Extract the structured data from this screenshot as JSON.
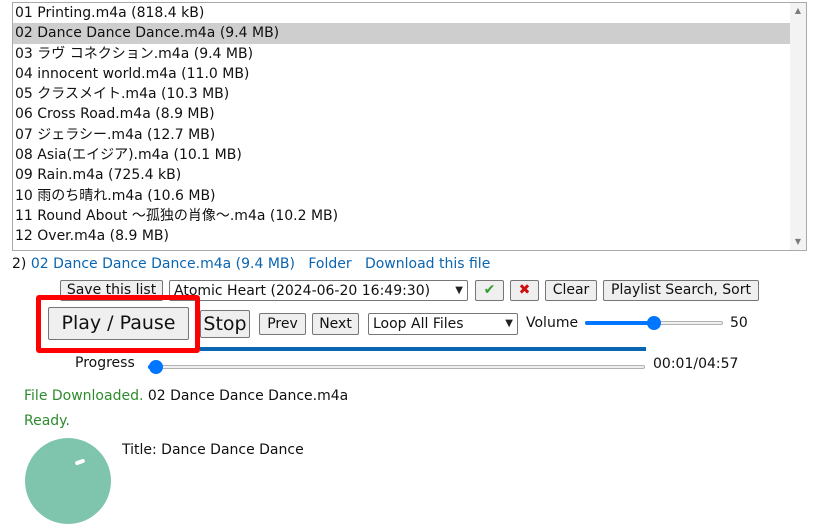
{
  "playlist": {
    "tracks": [
      "01 Printing.m4a (818.4 kB)",
      "02 Dance Dance Dance.m4a (9.4 MB)",
      "03 ラヴ コネクション.m4a (9.4 MB)",
      "04 innocent world.m4a (11.0 MB)",
      "05 クラスメイト.m4a (10.3 MB)",
      "06 Cross Road.m4a (8.9 MB)",
      "07 ジェラシー.m4a (12.7 MB)",
      "08 Asia(エイジア).m4a (10.1 MB)",
      "09 Rain.m4a (725.4 kB)",
      "10 雨のち晴れ.m4a (10.6 MB)",
      "11 Round About ～孤独の肖像～.m4a (10.2 MB)",
      "12 Over.m4a (8.9 MB)"
    ],
    "selected_index": 1
  },
  "info": {
    "index": "2)",
    "file_link": "02 Dance Dance Dance.m4a (9.4 MB)",
    "folder_link": "Folder",
    "download_link": "Download this file"
  },
  "toolbar": {
    "save_label": "Save this list",
    "playlist_select": "Atomic Heart (2024-06-20 16:49:30)",
    "confirm_icon": "✔",
    "delete_icon": "✖",
    "clear_label": "Clear",
    "search_label": "Playlist Search, Sort"
  },
  "controls": {
    "play_pause_label": "Play / Pause",
    "stop_label": "Stop",
    "prev_label": "Prev",
    "next_label": "Next",
    "loop_select": "Loop All Files",
    "volume_label": "Volume",
    "volume_value": "50",
    "volume_fraction": 0.5
  },
  "progress": {
    "label": "Progress",
    "time": "00:01/04:57",
    "fraction": 0.003
  },
  "status": {
    "downloaded_label": "File Downloaded.",
    "downloaded_file": "02 Dance Dance Dance.m4a",
    "ready": "Ready.",
    "title_line": "Title: Dance Dance Dance"
  },
  "colors": {
    "accent": "#0075ff",
    "link": "#0b65b0",
    "highlight": "#ff0000",
    "status_green": "#2e8b2e",
    "confirm_green": "#2e9e2e",
    "delete_red": "#d01010",
    "avatar": "#7fc5ad"
  }
}
